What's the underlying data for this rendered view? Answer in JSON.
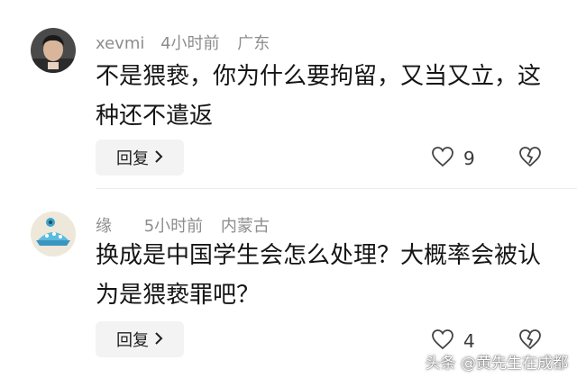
{
  "comments": [
    {
      "username": "xevmi",
      "time": "4小时前",
      "location": "广东",
      "text": "不是猥亵，你为什么要拘留，又当又立，这种还不遣返",
      "reply_label": "回复",
      "like_count": "9"
    },
    {
      "username": "缘",
      "time": "5小时前",
      "location": "内蒙古",
      "text": "换成是中国学生会怎么处理？大概率会被认为是猥亵罪吧？",
      "reply_label": "回复",
      "like_count": "4"
    }
  ],
  "watermark": "头条 @黄先生在成都",
  "icons": {
    "like": "heart-outline-icon",
    "dislike": "broken-heart-icon",
    "chevron": "chevron-right-icon"
  }
}
